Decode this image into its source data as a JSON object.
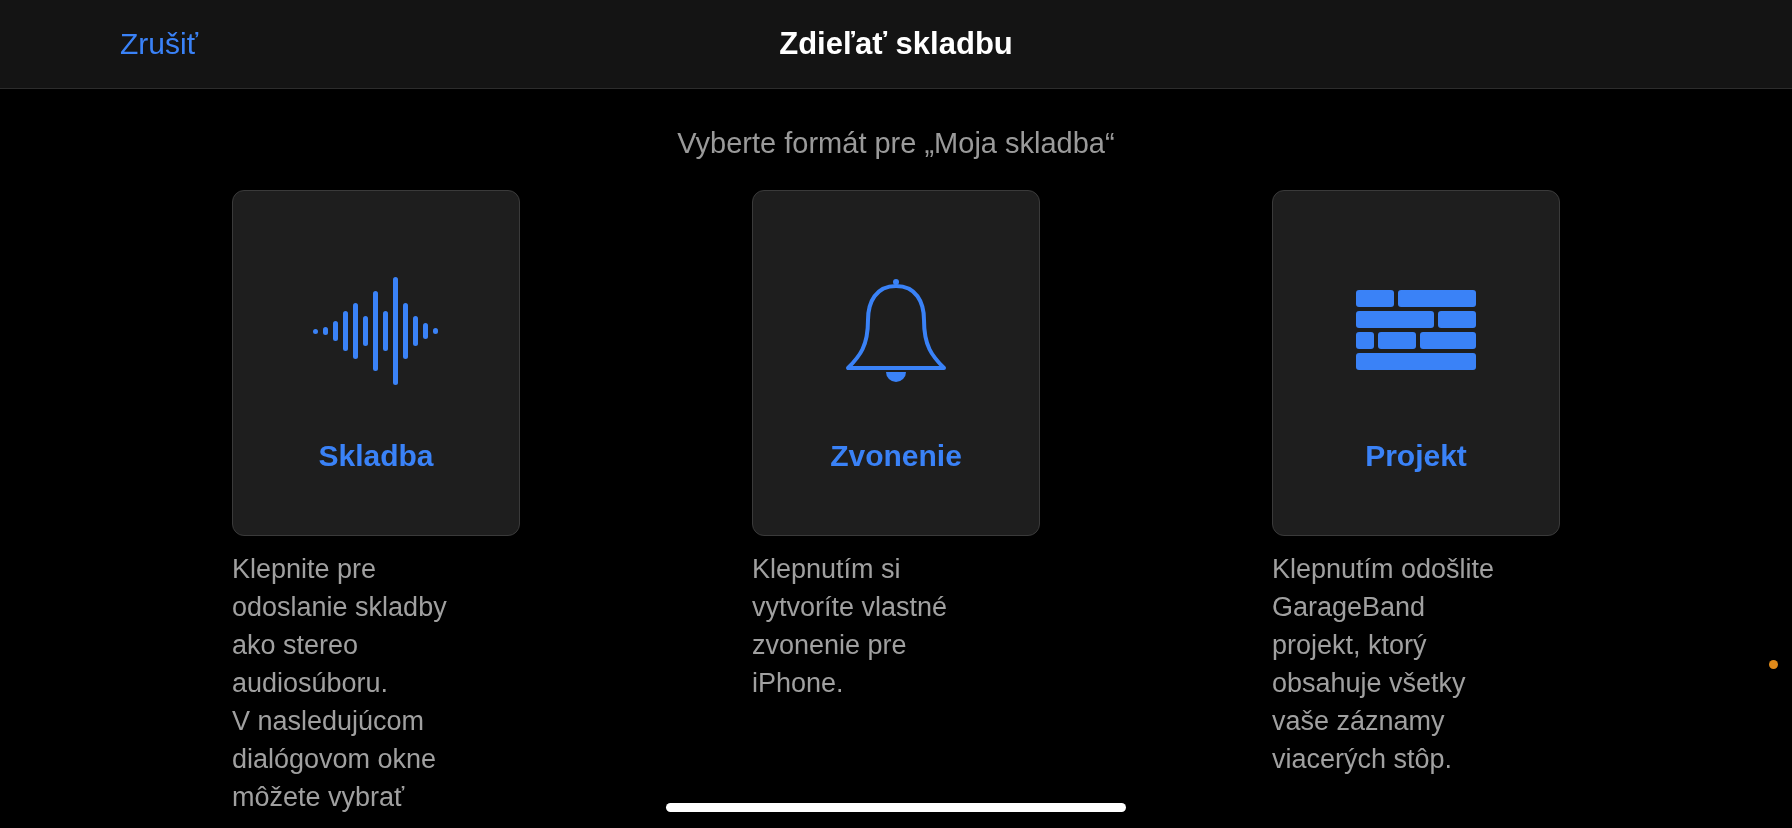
{
  "header": {
    "cancel": "Zrušiť",
    "title": "Zdieľať skladbu"
  },
  "prompt": "Vyberte formát pre „Moja skladba“",
  "options": [
    {
      "kind": "song",
      "label": "Skladba",
      "description": "Klepnite pre\nodoslanie skladby\nako stereo\naudiosúboru.\nV nasledujúcom\ndialógovom okne\nmôžete vybrať"
    },
    {
      "kind": "ringtone",
      "label": "Zvonenie",
      "description": "Klepnutím si\nvytvoríte vlastné\nzvonenie pre\niPhone."
    },
    {
      "kind": "project",
      "label": "Projekt",
      "description": "Klepnutím odošlite\nGarageBand\nprojekt, ktorý\nobsahuje všetky\nvaše záznamy\nviacerých stôp."
    }
  ]
}
